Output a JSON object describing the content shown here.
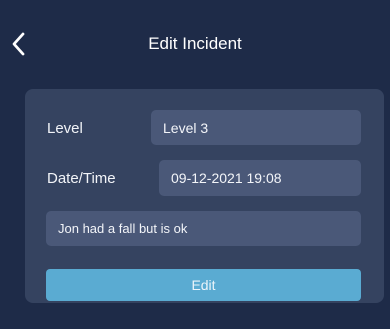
{
  "header": {
    "title": "Edit Incident",
    "back_icon": "chevron-left-icon"
  },
  "form": {
    "level": {
      "label": "Level",
      "value": "Level 3"
    },
    "datetime": {
      "label": "Date/Time",
      "value": "09-12-2021 19:08"
    },
    "notes": {
      "value": "Jon had a fall but is ok"
    },
    "submit_label": "Edit"
  },
  "colors": {
    "background": "#1e2b48",
    "card": "#354360",
    "field": "#4a5878",
    "accent": "#5aabd2"
  }
}
